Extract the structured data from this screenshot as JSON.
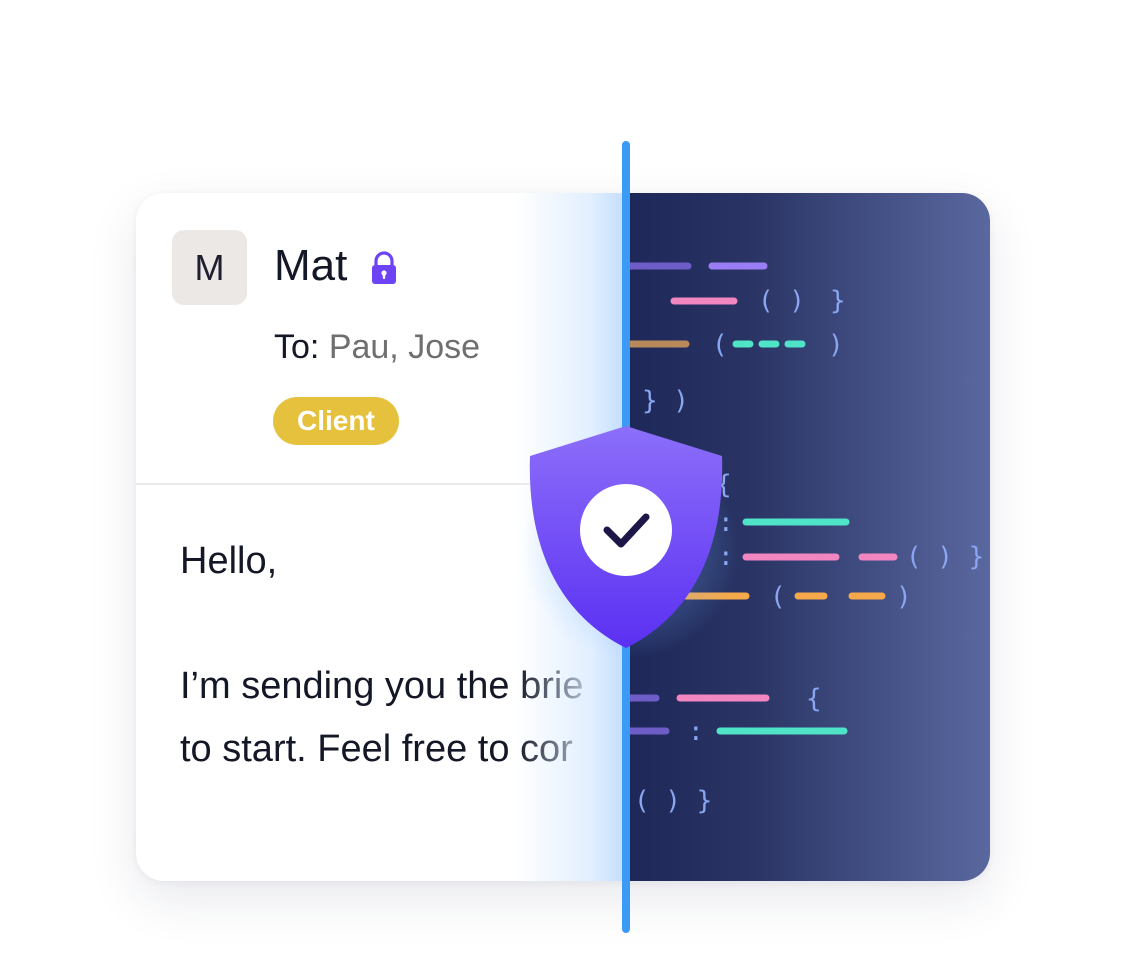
{
  "email": {
    "avatar_initial": "M",
    "sender": "Mat",
    "to_label": "To:",
    "recipients": "Pau, Jose",
    "tag": "Client",
    "greeting": "Hello,",
    "body_line1": "I’m sending you the brie",
    "body_line2": "to start. Feel free to cor"
  },
  "icons": {
    "lock": "lock-icon",
    "shield": "shield-check-icon",
    "check": "check-icon"
  },
  "colors": {
    "accent_purple": "#6c44f5",
    "divider_blue": "#3a9af5",
    "tag_yellow": "#e6c13e",
    "code_pink": "#f186c1",
    "code_teal": "#4fe3c8",
    "code_orange": "#f5a94a",
    "code_violet": "#9a7df5"
  }
}
